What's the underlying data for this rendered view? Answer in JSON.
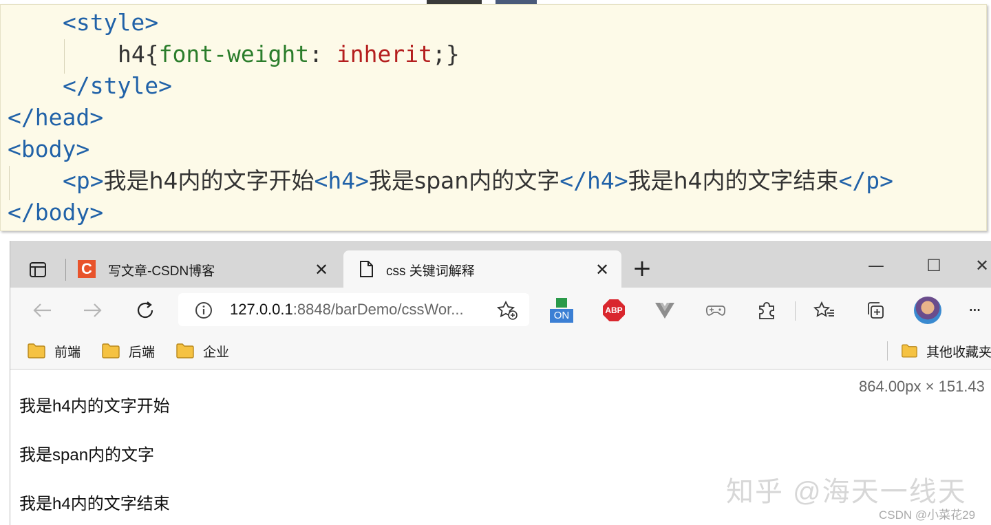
{
  "editor": {
    "lines": [
      {
        "parts": [
          [
            "tag",
            "<style>"
          ]
        ]
      },
      {
        "parts": [
          [
            "punct",
            "h4{"
          ],
          [
            "prop",
            "font-weight"
          ],
          [
            "punct",
            ": "
          ],
          [
            "val",
            "inherit"
          ],
          [
            "punct",
            ";}"
          ]
        ]
      },
      {
        "parts": [
          [
            "tag",
            "</style>"
          ]
        ]
      },
      {
        "parts": [
          [
            "tag",
            "</head>"
          ]
        ]
      },
      {
        "parts": [
          [
            "tag",
            "<body>"
          ]
        ]
      },
      {
        "parts": [
          [
            "tag",
            "<p>"
          ],
          [
            "txt",
            "我是h4内的文字开始"
          ],
          [
            "tag",
            "<h4>"
          ],
          [
            "txt",
            "我是span内的文字"
          ],
          [
            "tag",
            "</h4>"
          ],
          [
            "txt",
            "我是h4内的文字结束"
          ],
          [
            "tag",
            "</p>"
          ]
        ]
      },
      {
        "parts": [
          [
            "tag",
            "</body>"
          ]
        ]
      }
    ]
  },
  "browser": {
    "tabs": [
      {
        "title": "写文章-CSDN博客",
        "favicon": "csdn-c-icon",
        "favicon_color": "#e8532b",
        "favicon_letter": "C"
      },
      {
        "title": "css 关键词解释",
        "favicon": "page-icon"
      }
    ],
    "close_glyph": "✕",
    "new_tab_glyph": "+",
    "window": {
      "minimize": "—",
      "maximize": "☐",
      "close": "✕"
    },
    "address": {
      "host": "127.0.0.1",
      "rest": ":8848/barDemo/cssWor..."
    },
    "extensions": {
      "on_badge": "ON",
      "abp": "ABP"
    },
    "more_glyph": "···",
    "bookmarks": [
      "前端",
      "后端",
      "企业"
    ],
    "other_bookmarks": "其他收藏夹",
    "page": {
      "lines": [
        "我是h4内的文字开始",
        "我是span内的文字",
        "我是h4内的文字结束"
      ],
      "dimensions": "864.00px × 151.43",
      "watermark": "知乎 @海天一线天",
      "csdn_watermark": "CSDN @小菜花29"
    }
  },
  "colors": {
    "tag": "#2162a8",
    "property": "#2b7d2b",
    "value": "#b41e1e",
    "panel_bg": "#fdfae8",
    "accent_folder": "#f5c242"
  }
}
